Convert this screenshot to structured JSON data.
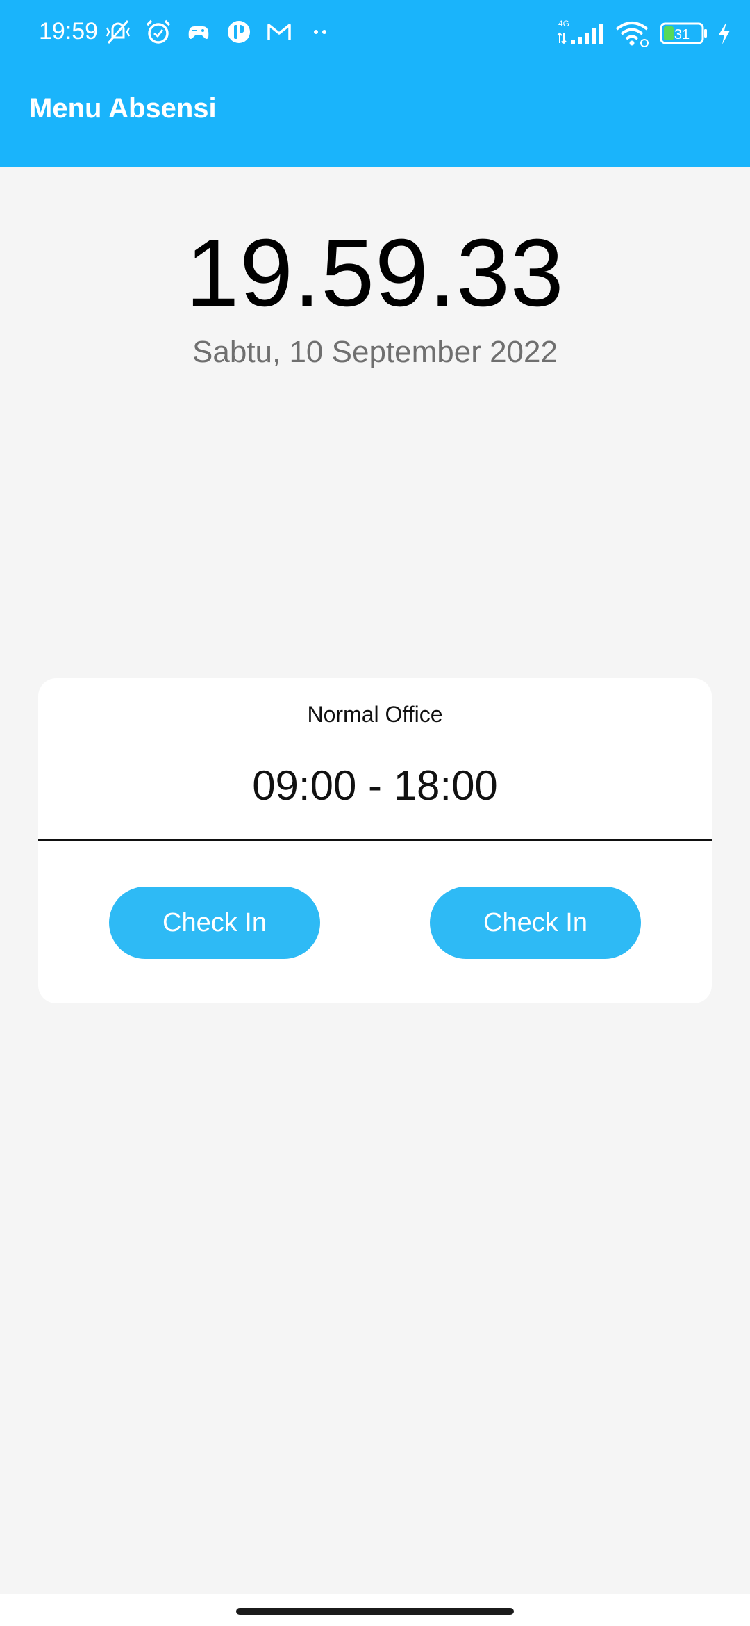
{
  "status_bar": {
    "time": "19:59",
    "network": "4G",
    "battery": "31",
    "icons": [
      "vibrate-off-icon",
      "alarm-icon",
      "game-controller-icon",
      "app-icon",
      "gmail-icon",
      "more-dots-icon",
      "signal-icon",
      "wifi-icon",
      "battery-icon",
      "charging-icon"
    ]
  },
  "app_bar": {
    "title": "Menu Absensi"
  },
  "clock": {
    "time": "19.59.33",
    "date": "Sabtu, 10 September 2022"
  },
  "shift_card": {
    "name": "Normal Office",
    "hours": "09:00 - 18:00",
    "buttons": [
      {
        "label": "Check In"
      },
      {
        "label": "Check In"
      }
    ]
  },
  "colors": {
    "app_bar": "#1ab4fb",
    "button": "#2ebaf5",
    "background": "#f5f5f5"
  }
}
